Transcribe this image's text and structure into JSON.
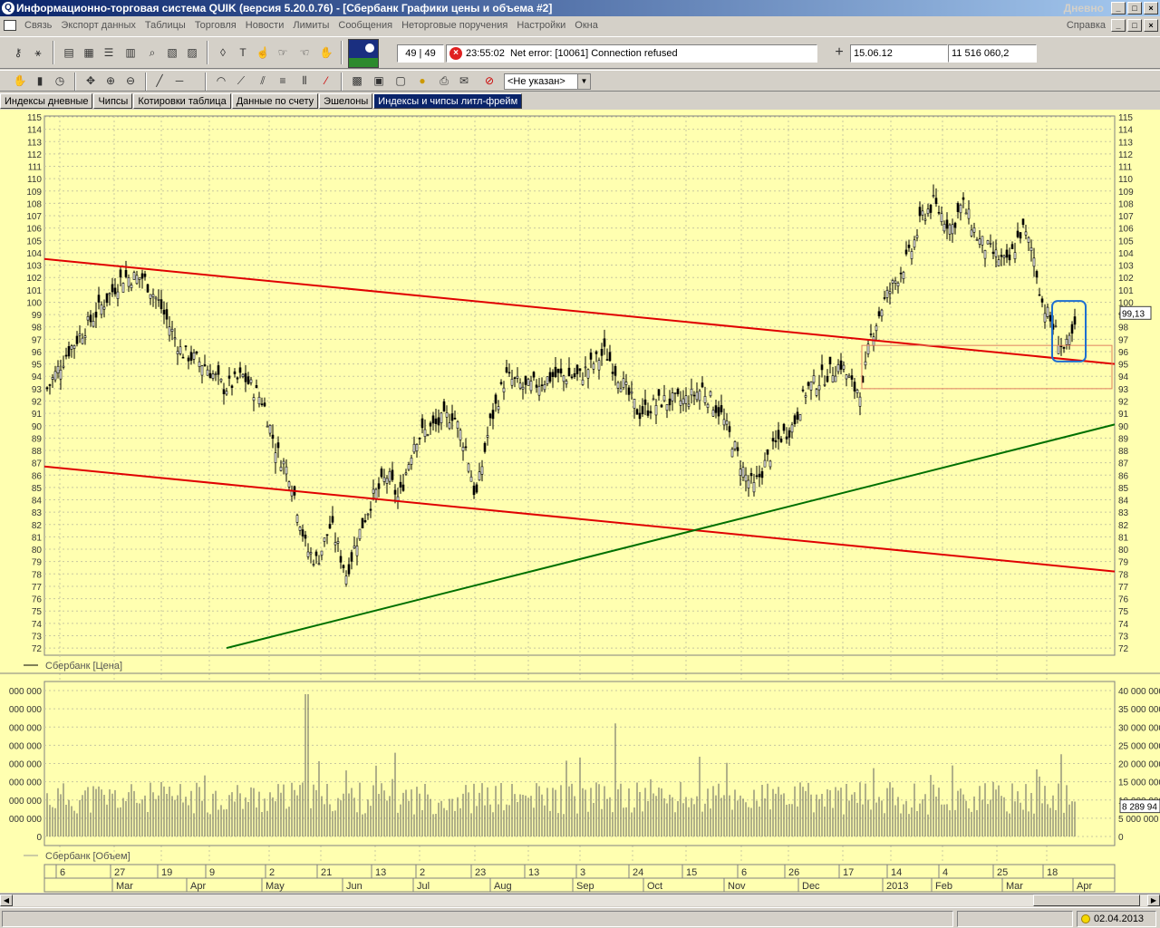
{
  "window": {
    "title": "Информационно-торговая система QUIK (версия 5.20.0.76) - [Сбербанк Графики цены и объема #2]",
    "title_right": "Дневно"
  },
  "menu": {
    "items": [
      "Связь",
      "Экспорт данных",
      "Таблицы",
      "Торговля",
      "Новости",
      "Лимиты",
      "Сообщения",
      "Неторговые поручения",
      "Настройки",
      "Окна"
    ],
    "help": "Справка"
  },
  "toolbar": {
    "counter": "49 | 49",
    "message_time": "23:55:02",
    "message": "Net error: [10061] Connection refused",
    "date": "15.06.12",
    "amount": "11 516 060,2",
    "class_select": "<Не указан>"
  },
  "tabs": [
    {
      "label": "Индексы дневные",
      "active": false
    },
    {
      "label": "Чипсы",
      "active": false
    },
    {
      "label": "Котировки таблица",
      "active": false
    },
    {
      "label": "Данные по счету",
      "active": false
    },
    {
      "label": "Эшелоны",
      "active": false
    },
    {
      "label": "Индексы и чипсы литл-фрейм",
      "active": true
    }
  ],
  "price_panel": {
    "legend": "Сбербанк [Цена]",
    "last_price": "99,13",
    "ylim": [
      72,
      115
    ]
  },
  "volume_panel": {
    "legend": "Сбербанк [Объем]",
    "last_volume": "8 289 94",
    "right_ticks": [
      "40 000 000",
      "35 000 000",
      "30 000 000",
      "25 000 000",
      "20 000 000",
      "15 000 000",
      "10 000 000",
      "5 000 000",
      "0"
    ],
    "left_ticks": [
      "000 000",
      "000 000",
      "000 000",
      "000 000",
      "000 000",
      "000 000",
      "000 000",
      "000 000",
      "0"
    ]
  },
  "time_axis": {
    "days": [
      "6",
      "27",
      "19",
      "9",
      "2",
      "21",
      "13",
      "2",
      "23",
      "13",
      "3",
      "24",
      "15",
      "6",
      "26",
      "17",
      "14",
      "4",
      "25",
      "18"
    ],
    "months": [
      "Mar",
      "Apr",
      "May",
      "Jun",
      "Jul",
      "Aug",
      "Sep",
      "Oct",
      "Nov",
      "Dec",
      "2013",
      "Feb",
      "Mar",
      "Apr"
    ]
  },
  "status": {
    "date": "02.04.2013"
  },
  "colors": {
    "chart_bg": "#ffffb0",
    "resistance_line": "#e00000",
    "support_line": "#007000",
    "highlight_box": "#1e6fd0"
  }
}
